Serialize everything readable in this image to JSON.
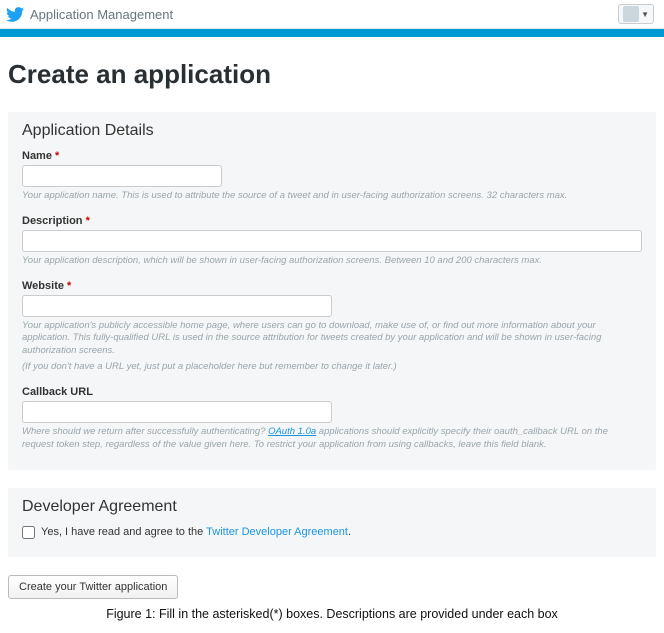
{
  "topbar": {
    "title": "Application Management"
  },
  "page": {
    "heading": "Create an application"
  },
  "sections": {
    "details": {
      "title": "Application Details",
      "name": {
        "label": "Name",
        "required": "*",
        "help": "Your application name. This is used to attribute the source of a tweet and in user-facing authorization screens. 32 characters max."
      },
      "description": {
        "label": "Description",
        "required": "*",
        "help": "Your application description, which will be shown in user-facing authorization screens. Between 10 and 200 characters max."
      },
      "website": {
        "label": "Website",
        "required": "*",
        "help1": "Your application's publicly accessible home page, where users can go to download, make use of, or find out more information about your application. This fully-qualified URL is used in the source attribution for tweets created by your application and will be shown in user-facing authorization screens.",
        "help2": "(If you don't have a URL yet, just put a placeholder here but remember to change it later.)"
      },
      "callback": {
        "label": "Callback URL",
        "help_pre": "Where should we return after successfully authenticating? ",
        "oauth_link_text": "OAuth 1.0a",
        "help_post": " applications should explicitly specify their oauth_callback URL on the request token step, regardless of the value given here. To restrict your application from using callbacks, leave this field blank."
      }
    },
    "agreement": {
      "title": "Developer Agreement",
      "checkbox_label_pre": "Yes, I have read and agree to the ",
      "link_text": "Twitter Developer Agreement",
      "checkbox_label_post": "."
    }
  },
  "actions": {
    "submit": "Create your Twitter application"
  },
  "caption": "Figure 1: Fill in the asterisked(*) boxes. Descriptions are provided under each box"
}
